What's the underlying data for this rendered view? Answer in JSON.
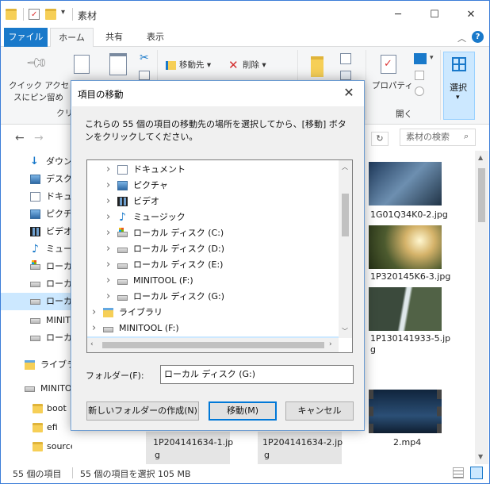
{
  "window": {
    "title": "素材",
    "caption_minimize": "─",
    "caption_maximize": "☐",
    "caption_close": "✕"
  },
  "ribbon_tabs": [
    "ファイル",
    "ホーム",
    "共有",
    "表示"
  ],
  "ribbon": {
    "pin_label_1": "クイック アクセ",
    "pin_label_2": "スにピン留め",
    "clip_group": "クリ",
    "move_to": "移動先",
    "delete": "削除",
    "properties": "プロパティ",
    "open_group": "開く",
    "select": "選択",
    "help": "?"
  },
  "search": {
    "placeholder": "素材の検索"
  },
  "navpane": [
    {
      "label": "ダウンロ",
      "icon": "download-icon"
    },
    {
      "label": "デスクト",
      "icon": "desktop-icon"
    },
    {
      "label": "ドキュメ",
      "icon": "document-icon"
    },
    {
      "label": "ピクチャ",
      "icon": "pictures-icon"
    },
    {
      "label": "ビデオ",
      "icon": "video-icon"
    },
    {
      "label": "ミュージ",
      "icon": "music-icon"
    },
    {
      "label": "ローカル",
      "icon": "system-drive-icon"
    },
    {
      "label": "ローカル",
      "icon": "drive-icon"
    },
    {
      "label": "ローカル",
      "icon": "drive-icon",
      "selected": true
    },
    {
      "label": "MINITO",
      "icon": "drive-icon"
    },
    {
      "label": "ローカル",
      "icon": "drive-icon"
    },
    {
      "label": "ライブラ",
      "icon": "library-icon"
    },
    {
      "label": "MINITO",
      "icon": "drive-icon"
    },
    {
      "label": "boot",
      "icon": "folder-icon"
    },
    {
      "label": "efi",
      "icon": "folder-icon"
    },
    {
      "label": "sources",
      "icon": "folder-icon"
    }
  ],
  "files": [
    {
      "name": "1G01Q34K0-2.jpg"
    },
    {
      "name": "1P320145K6-3.jpg"
    },
    {
      "name": "1P130141933-5.jp"
    },
    {
      "name_cont": "g"
    },
    {
      "name": "2.mp4"
    },
    {
      "name": "1P204141634-1.jp"
    },
    {
      "name": "1P204141634-2.jp"
    }
  ],
  "status": {
    "count": "55 個の項目",
    "selected": "55 個の項目を選択  105 MB"
  },
  "dialog": {
    "title": "項目の移動",
    "close": "✕",
    "instruction": "これらの 55 個の項目の移動先の場所を選択してから、[移動] ボタンをクリックしてください。",
    "tree": [
      {
        "label": "ドキュメント",
        "icon": "document-icon",
        "level": 2
      },
      {
        "label": "ピクチャ",
        "icon": "pictures-icon",
        "level": 2
      },
      {
        "label": "ビデオ",
        "icon": "video-icon",
        "level": 2
      },
      {
        "label": "ミュージック",
        "icon": "music-icon",
        "level": 2
      },
      {
        "label": "ローカル ディスク (C:)",
        "icon": "system-drive-icon",
        "level": 2
      },
      {
        "label": "ローカル ディスク (D:)",
        "icon": "drive-icon",
        "level": 2
      },
      {
        "label": "ローカル ディスク (E:)",
        "icon": "drive-icon",
        "level": 2
      },
      {
        "label": "MINITOOL (F:)",
        "icon": "drive-icon",
        "level": 2
      },
      {
        "label": "ローカル ディスク (G:)",
        "icon": "drive-icon",
        "level": 2
      },
      {
        "label": "ライブラリ",
        "icon": "library-icon",
        "level": 1
      },
      {
        "label": "MINITOOL (F:)",
        "icon": "drive-icon",
        "level": 1
      },
      {
        "label": "ローカル ディスク (G:)",
        "icon": "drive-icon",
        "level": 1,
        "selected": true
      }
    ],
    "folder_label": "フォルダー(F):",
    "folder_value": "ローカル ディスク (G:)",
    "btn_new_folder": "新しいフォルダーの作成(N)",
    "btn_move": "移動(M)",
    "btn_cancel": "キャンセル"
  }
}
